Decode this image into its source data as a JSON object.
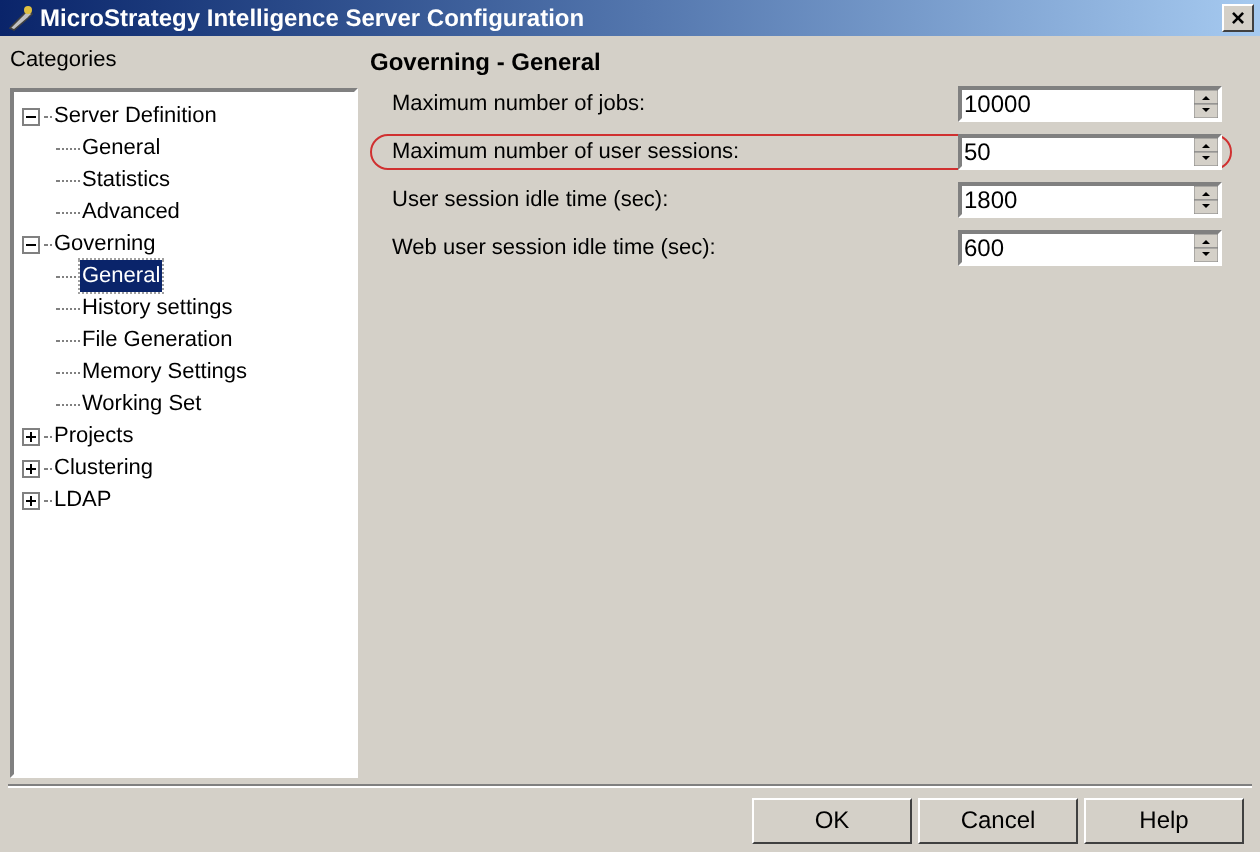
{
  "window": {
    "title": "MicroStrategy Intelligence Server Configuration",
    "close": "×"
  },
  "sidebar": {
    "title": "Categories",
    "tree": [
      {
        "label": "Server Definition",
        "expanded": true,
        "selected": false,
        "children": [
          {
            "label": "General",
            "selected": false
          },
          {
            "label": "Statistics",
            "selected": false
          },
          {
            "label": "Advanced",
            "selected": false
          }
        ]
      },
      {
        "label": "Governing",
        "expanded": true,
        "selected": false,
        "children": [
          {
            "label": "General",
            "selected": true
          },
          {
            "label": "History settings",
            "selected": false
          },
          {
            "label": "File Generation",
            "selected": false
          },
          {
            "label": "Memory Settings",
            "selected": false
          },
          {
            "label": "Working Set",
            "selected": false
          }
        ]
      },
      {
        "label": "Projects",
        "expanded": false,
        "selected": false
      },
      {
        "label": "Clustering",
        "expanded": false,
        "selected": false
      },
      {
        "label": "LDAP",
        "expanded": false,
        "selected": false
      }
    ]
  },
  "panel": {
    "title": "Governing - General",
    "fields": [
      {
        "label": "Maximum number of jobs:",
        "value": "10000",
        "highlighted": false
      },
      {
        "label": "Maximum number of user sessions:",
        "value": "50",
        "highlighted": true
      },
      {
        "label": "User session idle time (sec):",
        "value": "1800",
        "highlighted": false
      },
      {
        "label": "Web user session idle time (sec):",
        "value": "600",
        "highlighted": false
      }
    ]
  },
  "buttons": [
    {
      "label": "OK"
    },
    {
      "label": "Cancel"
    },
    {
      "label": "Help"
    }
  ]
}
